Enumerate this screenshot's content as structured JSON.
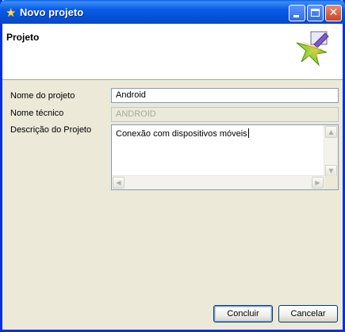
{
  "window": {
    "title": "Novo projeto",
    "icon": "star-icon",
    "controls": [
      "minimize",
      "maximize",
      "close"
    ]
  },
  "header": {
    "title": "Projeto",
    "logo_icon": "wizard-logo-icon"
  },
  "form": {
    "project_name": {
      "label": "Nome do projeto",
      "value": "Android"
    },
    "technical_name": {
      "label": "Nome técnico",
      "value": "ANDROID",
      "disabled": true
    },
    "description": {
      "label": "Descrição do Projeto",
      "value": "Conexão com dispositivos móveis"
    }
  },
  "buttons": {
    "finish_label": "Concluir",
    "cancel_label": "Cancelar"
  },
  "colors": {
    "titlebar": "#0a5ce8",
    "frame": "#0831d9",
    "dialog_bg": "#ece9d8",
    "input_border": "#7f9db9"
  }
}
